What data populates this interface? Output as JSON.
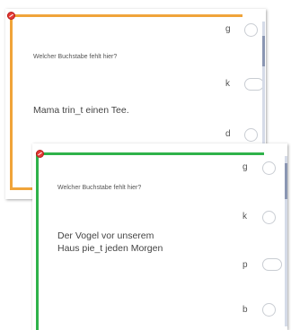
{
  "colors": {
    "card1_accent": "#f0a43a",
    "card2_accent": "#2fb24a",
    "error_dot": "#e53935"
  },
  "card1": {
    "question": "Welcher Buchstabe fehlt hier?",
    "sentence": "Mama trin_t einen Tee.",
    "options": [
      "g",
      "k",
      "d"
    ]
  },
  "card2": {
    "question": "Welcher Buchstabe fehlt hier?",
    "sentence_line1": "Der Vogel vor unserem",
    "sentence_line2": "Haus pie_t jeden Morgen",
    "options": [
      "g",
      "k",
      "p",
      "b"
    ]
  }
}
